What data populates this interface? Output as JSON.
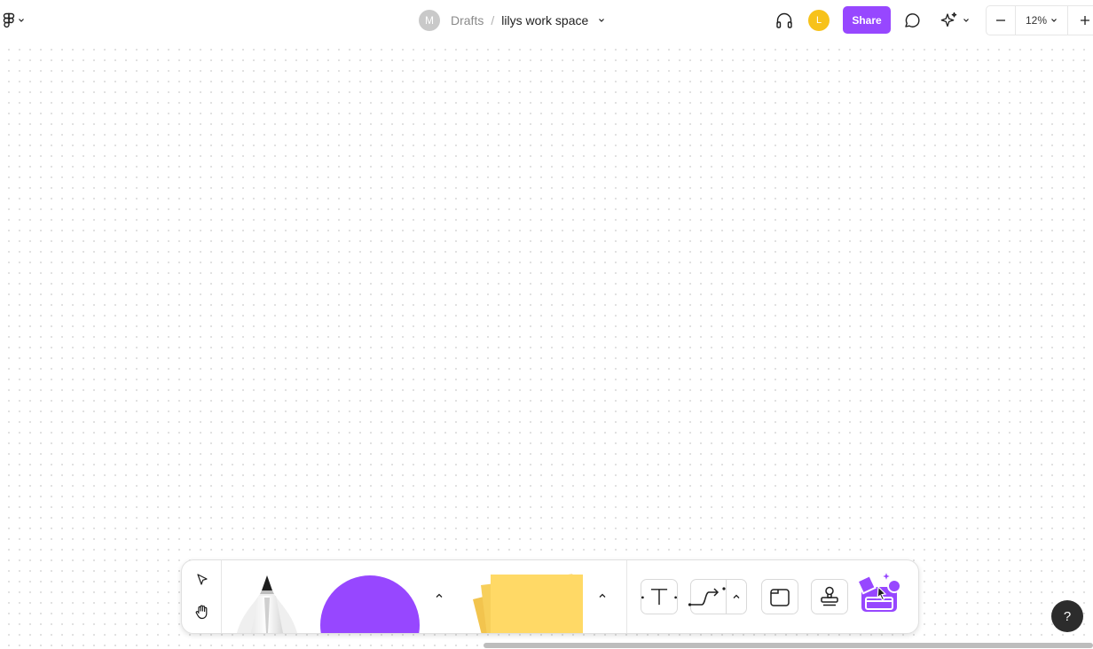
{
  "header": {
    "avatar_initial": "M",
    "breadcrumb_folder": "Drafts",
    "breadcrumb_separator": "/",
    "file_name": "lilys work space",
    "user_initial": "L",
    "share_label": "Share",
    "zoom_level": "12%"
  },
  "help": {
    "label": "?"
  },
  "colors": {
    "accent": "#9747ff",
    "shape_fill": "#9747ff",
    "sticky": "#ffd966",
    "user_avatar": "#f7c21a",
    "help_bg": "#2c2c2c"
  },
  "icons": {
    "menu": "figma-logo-icon",
    "headphones": "headphones-icon",
    "comment": "comment-icon",
    "ai": "sparkle-icon",
    "zoom_out": "minus-icon",
    "zoom_in": "plus-icon",
    "move": "cursor-arrow-icon",
    "hand": "hand-icon",
    "pen": "marker-pen-icon",
    "shape": "circle-shape-icon",
    "sticky": "sticky-note-icon",
    "text": "text-icon",
    "connector": "connector-icon",
    "section": "section-icon",
    "stamp": "stamp-icon",
    "more": "more-tools-icon"
  }
}
